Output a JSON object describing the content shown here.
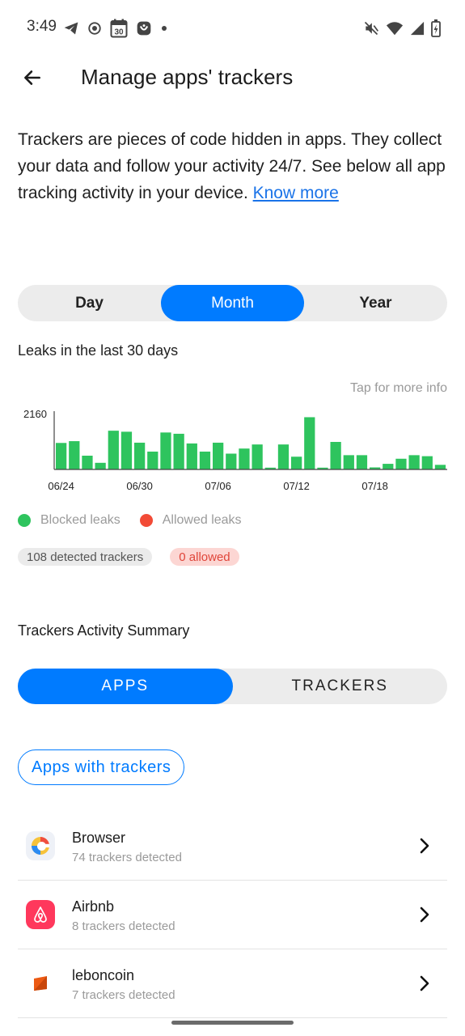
{
  "status_bar": {
    "time": "3:49",
    "calendar_day": "30",
    "icons_left": [
      "telegram-icon",
      "record-icon",
      "calendar-icon",
      "app-notification-icon",
      "dot-icon"
    ],
    "icons_right": [
      "mute-icon",
      "wifi-icon",
      "signal-icon",
      "battery-icon"
    ]
  },
  "header": {
    "title": "Manage apps' trackers"
  },
  "intro": {
    "text": "Trackers are pieces of code hidden in apps. They collect your data and follow your activity 24/7. See below all app tracking activity in your device. ",
    "link": "Know more"
  },
  "period_tabs": [
    {
      "label": "Day",
      "active": false
    },
    {
      "label": "Month",
      "active": true
    },
    {
      "label": "Year",
      "active": false
    }
  ],
  "leaks_title": "Leaks in the last 30 days",
  "tap_info": "Tap for more info",
  "chart_data": {
    "type": "bar",
    "y_tick": "2160",
    "ylim": [
      0,
      2160
    ],
    "x_ticks": [
      {
        "label": "06/24",
        "index": 0
      },
      {
        "label": "06/30",
        "index": 6
      },
      {
        "label": "07/06",
        "index": 12
      },
      {
        "label": "07/12",
        "index": 18
      },
      {
        "label": "07/18",
        "index": 24
      }
    ],
    "series": [
      {
        "name": "Blocked leaks",
        "color": "#2ec45e",
        "values": [
          1040,
          1110,
          540,
          260,
          1520,
          1480,
          1050,
          700,
          1450,
          1400,
          1020,
          700,
          1050,
          620,
          820,
          980,
          70,
          980,
          500,
          2050,
          70,
          1080,
          560,
          560,
          80,
          220,
          420,
          560,
          520,
          180
        ]
      },
      {
        "name": "Allowed leaks",
        "color": "#f24b36",
        "values": [
          0,
          0,
          0,
          0,
          0,
          0,
          0,
          0,
          0,
          0,
          0,
          0,
          0,
          0,
          0,
          0,
          0,
          0,
          0,
          0,
          0,
          0,
          0,
          0,
          0,
          0,
          0,
          0,
          0,
          0
        ]
      }
    ]
  },
  "legend": {
    "blocked": "Blocked leaks",
    "allowed": "Allowed leaks",
    "blocked_color": "#2ec45e",
    "allowed_color": "#f24b36"
  },
  "chips": {
    "detected": "108 detected trackers",
    "allowed": "0 allowed"
  },
  "summary": {
    "title": "Trackers Activity Summary",
    "tabs": [
      {
        "label": "APPS",
        "active": true
      },
      {
        "label": "TRACKERS",
        "active": false
      }
    ],
    "filter_button": "Apps with trackers"
  },
  "apps": [
    {
      "name": "Browser",
      "subtitle": "74 trackers detected",
      "icon": "browser-icon"
    },
    {
      "name": "Airbnb",
      "subtitle": "8 trackers detected",
      "icon": "airbnb-icon"
    },
    {
      "name": "leboncoin",
      "subtitle": "7 trackers detected",
      "icon": "leboncoin-icon"
    }
  ],
  "colors": {
    "accent": "#007bff",
    "link": "#1a73e8",
    "segment_bg": "#ececec"
  }
}
